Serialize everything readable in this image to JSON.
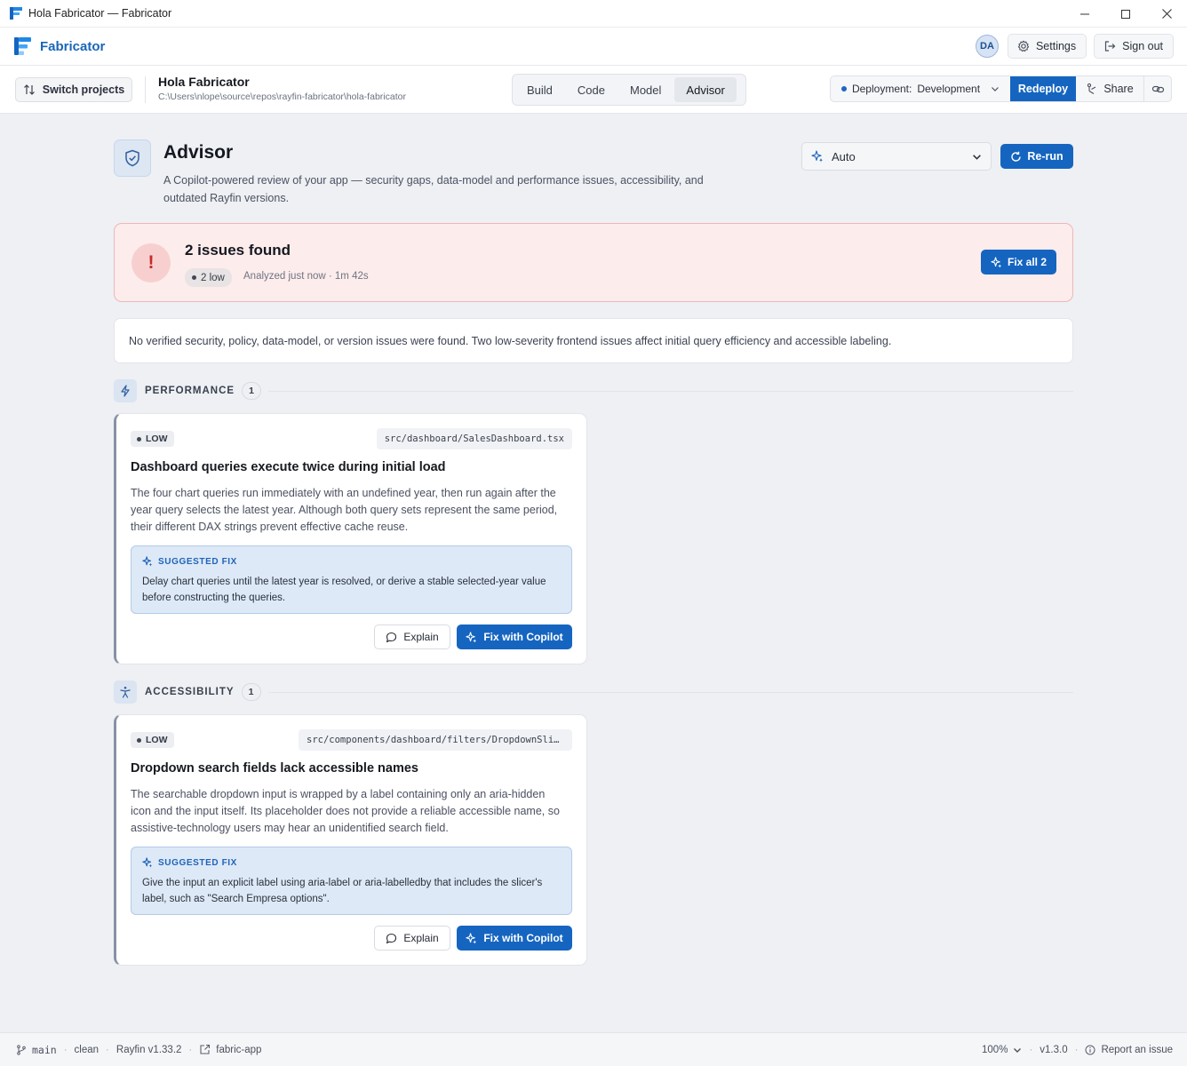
{
  "window": {
    "title": "Hola Fabricator — Fabricator"
  },
  "header": {
    "brand": "Fabricator",
    "avatar_initials": "DA",
    "settings_label": "Settings",
    "signout_label": "Sign out"
  },
  "project": {
    "switch_label": "Switch projects",
    "name": "Hola Fabricator",
    "path": "C:\\Users\\nlope\\source\\repos\\rayfin-fabricator\\hola-fabricator"
  },
  "tabs": [
    {
      "label": "Build"
    },
    {
      "label": "Code"
    },
    {
      "label": "Model"
    },
    {
      "label": "Advisor",
      "active": true
    }
  ],
  "deploy": {
    "label": "Deployment:",
    "value": "Development",
    "redeploy_label": "Redeploy",
    "share_label": "Share"
  },
  "advisor": {
    "title": "Advisor",
    "description": "A Copilot-powered review of your app — security gaps, data-model and performance issues, accessibility, and outdated Rayfin versions.",
    "model_value": "Auto",
    "rerun_label": "Re-run"
  },
  "issues": {
    "title": "2 issues found",
    "pill": "2 low",
    "analyzed": "Analyzed just now · 1m 42s",
    "fixall_label": "Fix all 2",
    "summary": "No verified security, policy, data-model, or version issues were found. Two low-severity frontend issues affect initial query efficiency and accessible labeling."
  },
  "sections": [
    {
      "label": "PERFORMANCE",
      "count": "1",
      "card": {
        "severity": "LOW",
        "file": "src/dashboard/SalesDashboard.tsx",
        "title": "Dashboard queries execute twice during initial load",
        "description": "The four chart queries run immediately with an undefined year, then run again after the year query selects the latest year. Although both query sets represent the same period, their different DAX strings prevent effective cache reuse.",
        "fix_label": "SUGGESTED FIX",
        "fix_text": "Delay chart queries until the latest year is resolved, or derive a stable selected-year value before constructing the queries.",
        "explain_label": "Explain",
        "fix_button_label": "Fix with Copilot"
      }
    },
    {
      "label": "ACCESSIBILITY",
      "count": "1",
      "card": {
        "severity": "LOW",
        "file": "src/components/dashboard/filters/DropdownSlicer…",
        "title": "Dropdown search fields lack accessible names",
        "description": "The searchable dropdown input is wrapped by a label containing only an aria-hidden icon and the input itself. Its placeholder does not provide a reliable accessible name, so assistive-technology users may hear an unidentified search field.",
        "fix_label": "SUGGESTED FIX",
        "fix_text": "Give the input an explicit label using aria-label or aria-labelledby that includes the slicer's label, such as \"Search Empresa options\".",
        "explain_label": "Explain",
        "fix_button_label": "Fix with Copilot"
      }
    }
  ],
  "status": {
    "branch": "main",
    "branch_state": "clean",
    "rayfin": "Rayfin v1.33.2",
    "app": "fabric-app",
    "zoom": "100%",
    "version": "v1.3.0",
    "report_label": "Report an issue"
  },
  "colors": {
    "accent": "#1565c0",
    "alert_bg": "#fdecec",
    "alert_border": "#efb7b7",
    "fix_bg": "#dde9f7"
  }
}
